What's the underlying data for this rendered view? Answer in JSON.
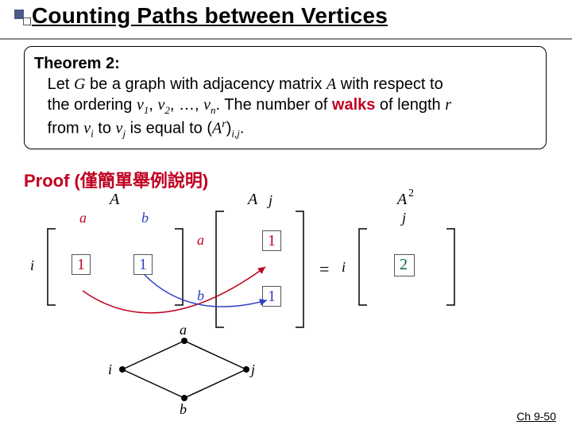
{
  "title": "Counting Paths between Vertices",
  "theorem": {
    "head": "Theorem 2:",
    "line1a": "Let ",
    "G": "G",
    "line1b": " be a graph with adjacency matrix ",
    "A": "A",
    "line1c": " with respect to ",
    "line2a": "the ordering ",
    "v1": "v",
    "s1": "1",
    "c": ", ",
    "v2": "v",
    "s2": "2",
    "dots": ", …, ",
    "vn": "v",
    "sn": "n",
    "line2b": ". The number of ",
    "walks": "walks",
    "line2c": " of length ",
    "r": "r",
    "line3a": "from ",
    "vi": "v",
    "si": "i",
    "to": " to ",
    "vj": "v",
    "sj": "j",
    "line3b": " is equal to (",
    "Ar": "A",
    "rp": "r",
    "line3c": ")",
    "ij": "i,j",
    "period": "."
  },
  "proof_head": "Proof (僅簡單舉例說明)",
  "labels": {
    "A1": "A",
    "A2": "A",
    "A2sq": "A",
    "sq": "2",
    "i": "i",
    "j": "j",
    "a": "a",
    "b": "b",
    "eq": "="
  },
  "mat": {
    "row_i": [
      "1",
      "1"
    ],
    "col_a": "1",
    "col_b": "1",
    "result": "2"
  },
  "graph": {
    "i": "i",
    "j": "j",
    "a": "a",
    "b": "b"
  },
  "footer": "Ch 9-50",
  "chart_data": {
    "type": "table",
    "title": "Matrix product illustration A·A = A^2, entry (i,j)",
    "matrix_A_row_i": {
      "columns": [
        "a",
        "b"
      ],
      "values": [
        1,
        1
      ]
    },
    "matrix_A_col_j": {
      "rows": [
        "a",
        "b"
      ],
      "values": [
        1,
        1
      ]
    },
    "A2_entry_ij": 2,
    "graph_edges": [
      [
        "i",
        "a"
      ],
      [
        "i",
        "b"
      ],
      [
        "a",
        "j"
      ],
      [
        "b",
        "j"
      ]
    ]
  }
}
